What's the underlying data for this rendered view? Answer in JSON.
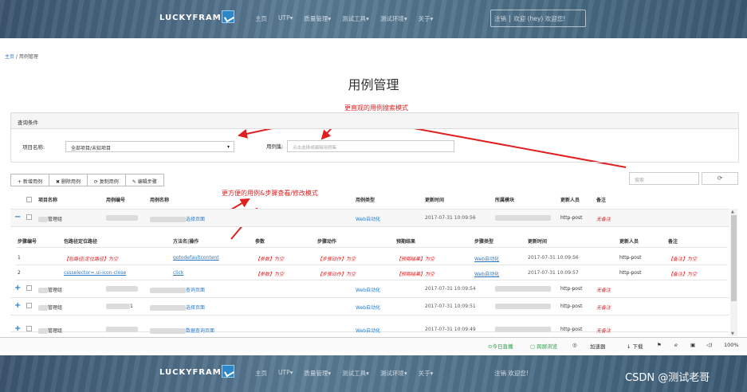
{
  "nav": {
    "logo": "LUCKYFRAME",
    "items": [
      "主页",
      "UTP▾",
      "质量管理▾",
      "测试工具▾",
      "测试环境▾",
      "关于▾"
    ],
    "user": "注销  │  欢迎 (hey) 欢迎您!"
  },
  "bottom_nav": {
    "logo": "LUCKYFRAME",
    "items": [
      "主页",
      "UTP▾",
      "质量管理▾",
      "测试工具▾",
      "测试环境▾",
      "关于▾"
    ],
    "user": "注销  欢迎您!"
  },
  "breadcrumb": {
    "home": "主页",
    "sep": "/",
    "current": "用例管理"
  },
  "page_title": "用例管理",
  "annotations": {
    "search": "更直观的用例搜索模式",
    "view": "更方便的用例&步骤查看/修改模式"
  },
  "query": {
    "header": "查询条件",
    "project_label": "项目名称:",
    "project_value": "全部项目/未知项目",
    "caret": "▾",
    "caseset_label": "用例集:",
    "caseset_placeholder": "点击选择或编辑用例集"
  },
  "toolbar": {
    "add": "+ 新增用例",
    "delete": "✖ 删除用例",
    "copy": "⟳ 复制用例",
    "edit": "✎ 编辑步骤",
    "search_placeholder": "搜索",
    "refresh": "⟳"
  },
  "table": {
    "headers": [
      "项目名称",
      "用例编号",
      "用例名称",
      "用例类型",
      "更新时间",
      "所属模块",
      "更新人员",
      "备注"
    ],
    "rows": [
      {
        "toggle": "−",
        "project": "管理组",
        "name_suffix": "选择页面",
        "type": "Web自动化",
        "time": "2017-07-31 10:09:56",
        "updater": "http-post",
        "remark": "无备注"
      },
      {
        "toggle": "+",
        "project": "管理组",
        "name_suffix": "查询页面",
        "type": "Web自动化",
        "time": "2017-07-31 10:09:54",
        "updater": "http-post",
        "remark": "无备注"
      },
      {
        "toggle": "+",
        "project": "管理组",
        "case_no_suffix": "1",
        "name_suffix": "选择页面",
        "type": "Web自动化",
        "time": "2017-07-31 10:09:51",
        "updater": "http-post",
        "remark": "无备注"
      },
      {
        "toggle": "+",
        "project": "管理组",
        "name_suffix": "数据查询页面",
        "type": "Web自动化",
        "time": "2017-07-31 10:09:49",
        "updater": "http-post",
        "remark": "无备注"
      }
    ]
  },
  "steps": {
    "headers": [
      "步骤编号",
      "包路径定位路径",
      "方法名|操作",
      "参数",
      "步骤动作",
      "预期结果",
      "步骤类型",
      "更新时间",
      "更新人员",
      "备注"
    ],
    "rows": [
      {
        "no": "1",
        "path": "【包路径|定位路径】为空",
        "method": "gotodefaultcontent",
        "param": "【参数】为空",
        "action": "【步骤动作】为空",
        "expect": "【预期结果】为空",
        "type": "Web自动化",
        "time": "2017-07-31 10:09:56",
        "updater": "http-post",
        "remark": "【备注】为空"
      },
      {
        "no": "2",
        "path": "cssselector=.ui-icon-close",
        "method": "click",
        "param": "【参数】为空",
        "action": "【步骤动作】为空",
        "expect": "【预期结果】为空",
        "type": "Web自动化",
        "time": "2017-07-31 10:09:57",
        "updater": "http-post",
        "remark": "【备注】为空"
      }
    ]
  },
  "statusbar": {
    "live": "⊙今日直播",
    "browse": "▢ 跨屏浏览",
    "accel": "加速器",
    "download": "↓ 下载",
    "zoom": "100%"
  },
  "watermark": "CSDN @测试老哥",
  "colors": {
    "link": "#2b78c5",
    "annotation": "#e02020",
    "nav": "#4d6f88"
  }
}
